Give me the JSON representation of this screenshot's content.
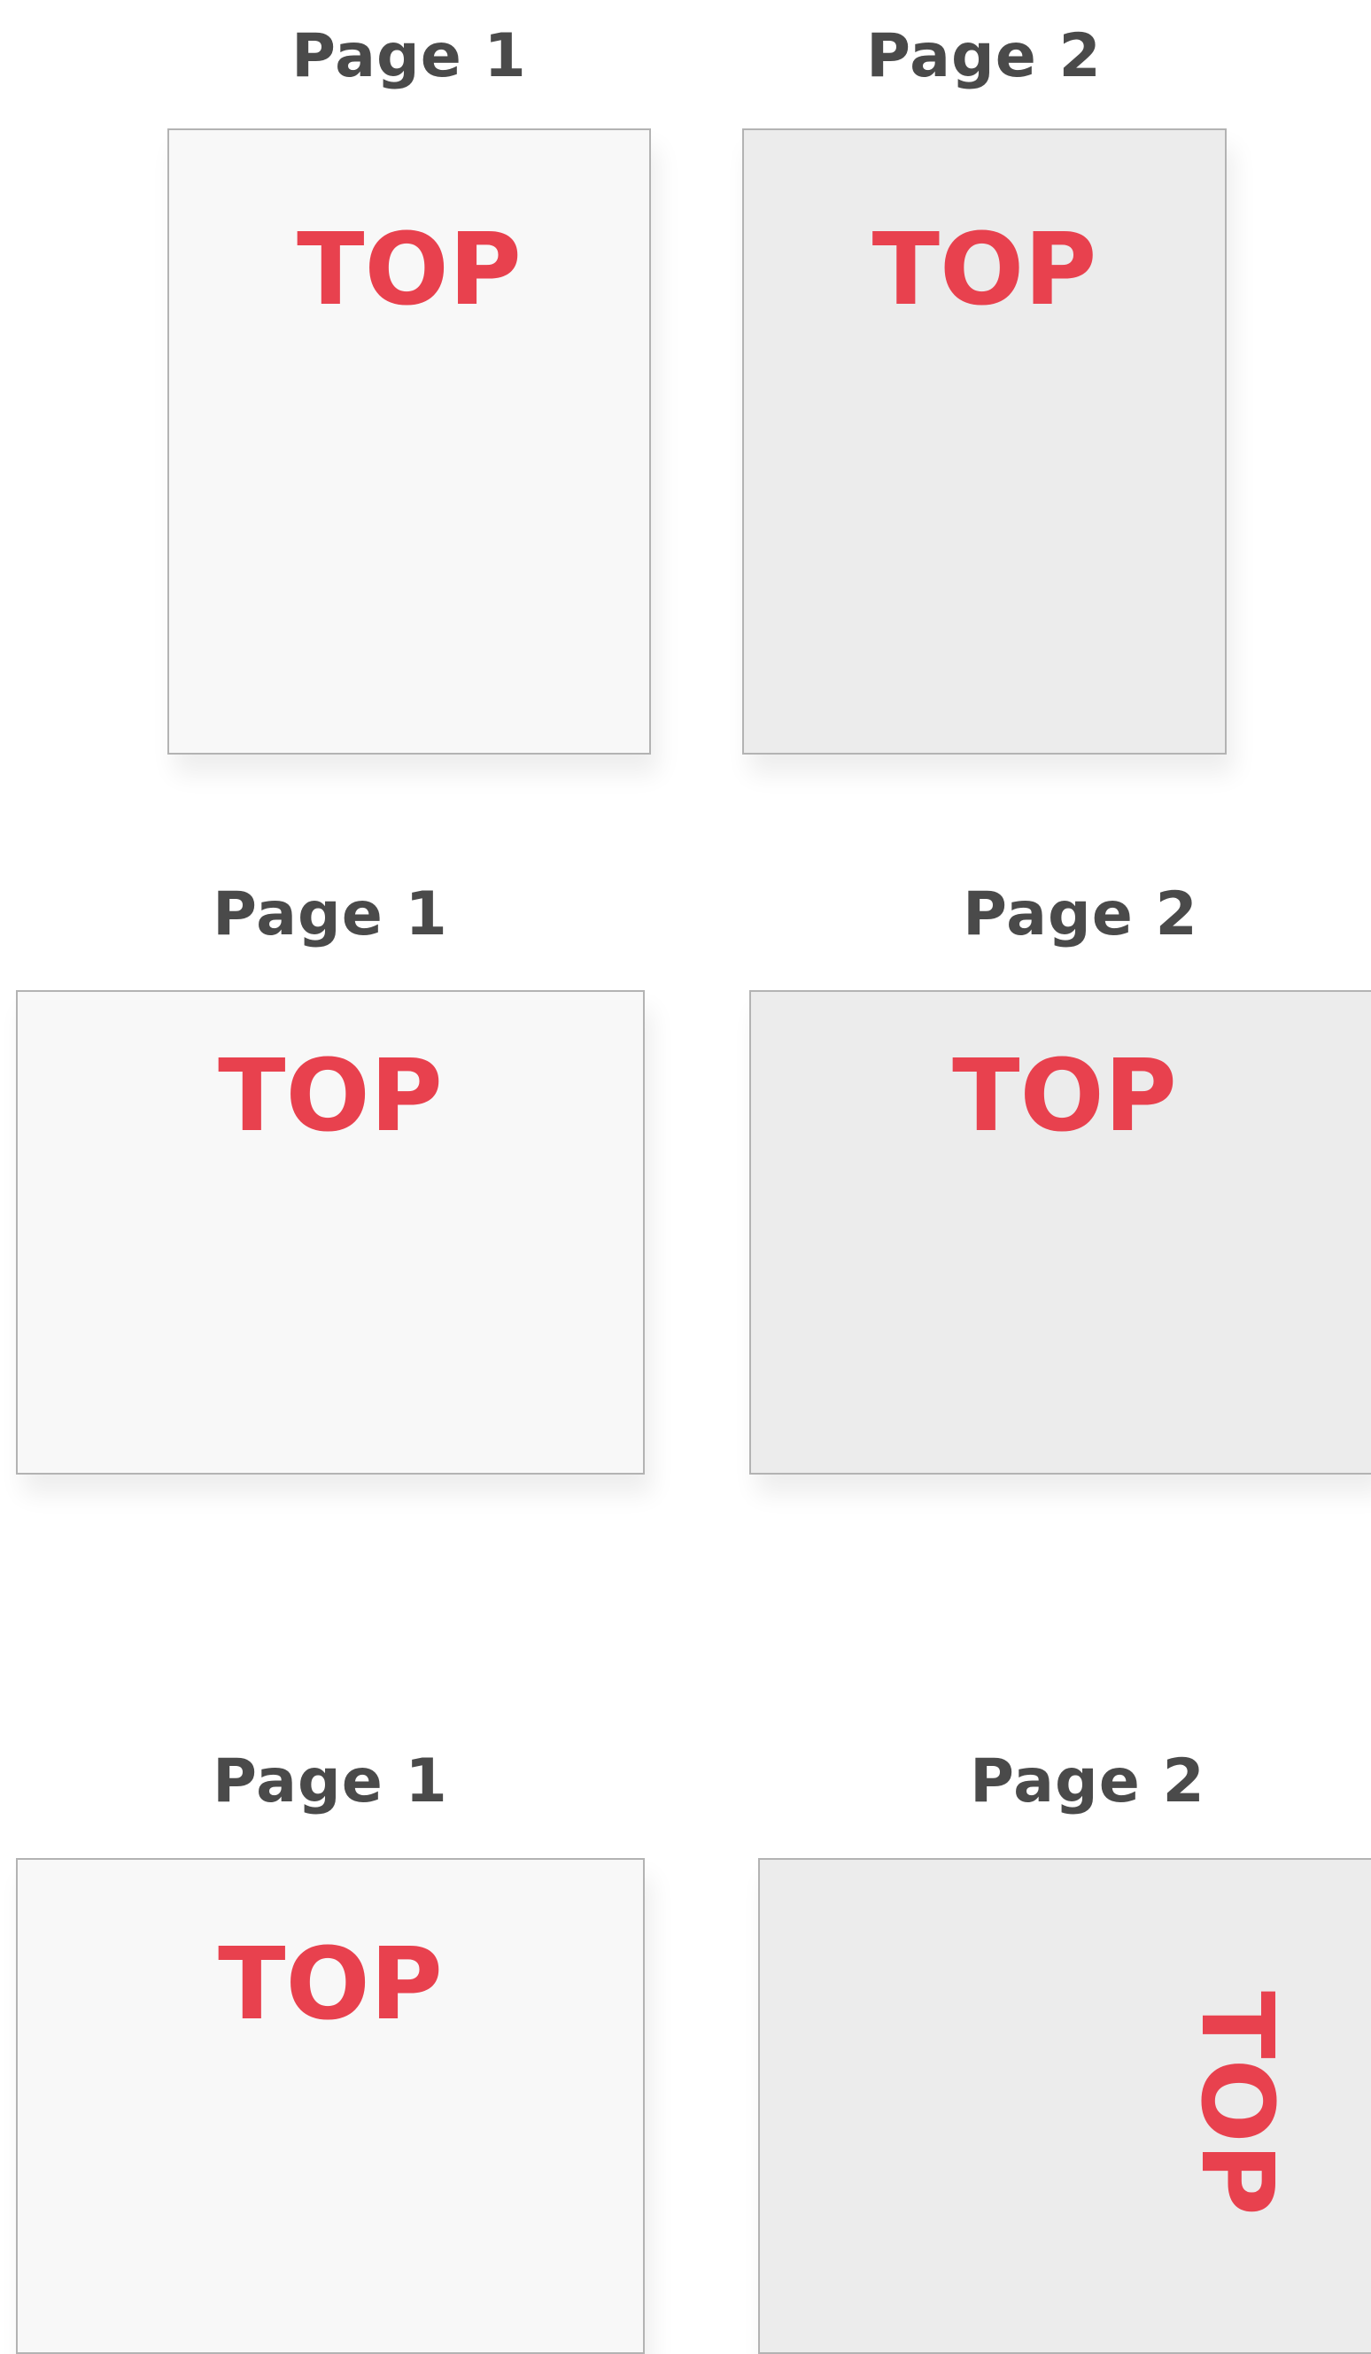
{
  "colors": {
    "label": "#4a4a4a",
    "top_text": "#e8414e",
    "page1_fill": "#f8f8f8",
    "page2_fill": "#ececec",
    "page_border": "#b3b3b3"
  },
  "rows": [
    {
      "page1": {
        "label": "Page 1",
        "text": "TOP"
      },
      "page2": {
        "label": "Page 2",
        "text": "TOP"
      }
    },
    {
      "page1": {
        "label": "Page 1",
        "text": "TOP"
      },
      "page2": {
        "label": "Page 2",
        "text": "TOP"
      }
    },
    {
      "page1": {
        "label": "Page 1",
        "text": "TOP"
      },
      "page2": {
        "label": "Page 2",
        "text": "TOP"
      }
    }
  ]
}
